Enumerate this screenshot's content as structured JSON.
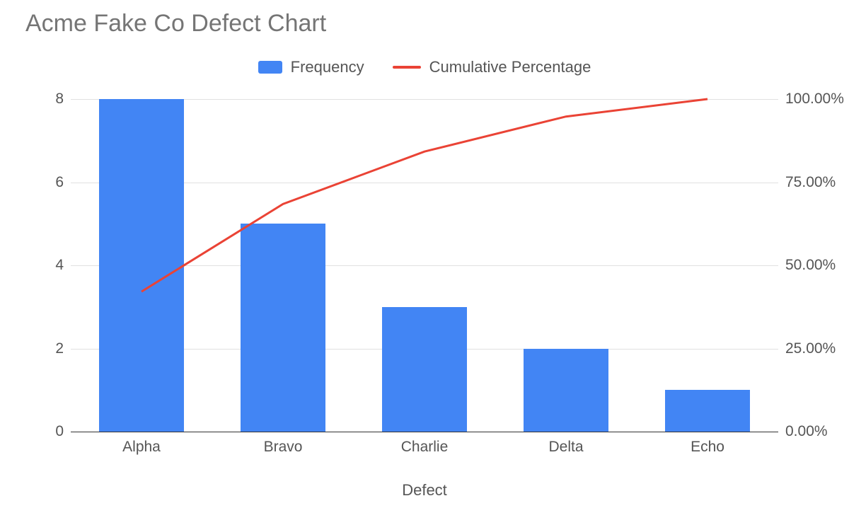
{
  "title": "Acme Fake Co Defect Chart",
  "legend": {
    "frequency": "Frequency",
    "cumulative": "Cumulative Percentage"
  },
  "xlabel": "Defect",
  "chart_data": {
    "type": "bar",
    "categories": [
      "Alpha",
      "Bravo",
      "Charlie",
      "Delta",
      "Echo"
    ],
    "series": [
      {
        "name": "Frequency",
        "type": "bar",
        "values": [
          8,
          5,
          3,
          2,
          1
        ]
      },
      {
        "name": "Cumulative Percentage",
        "type": "line",
        "values": [
          42.11,
          68.42,
          84.21,
          94.74,
          100.0
        ]
      }
    ],
    "y_left": {
      "min": 0,
      "max": 8,
      "ticks": [
        0,
        2,
        4,
        6,
        8
      ]
    },
    "y_right": {
      "min": 0,
      "max": 100,
      "ticks": [
        "0.00%",
        "25.00%",
        "50.00%",
        "75.00%",
        "100.00%"
      ]
    },
    "xlabel": "Defect",
    "title": "Acme Fake Co Defect Chart",
    "bar_color": "#4285f4",
    "line_color": "#ea4335"
  }
}
